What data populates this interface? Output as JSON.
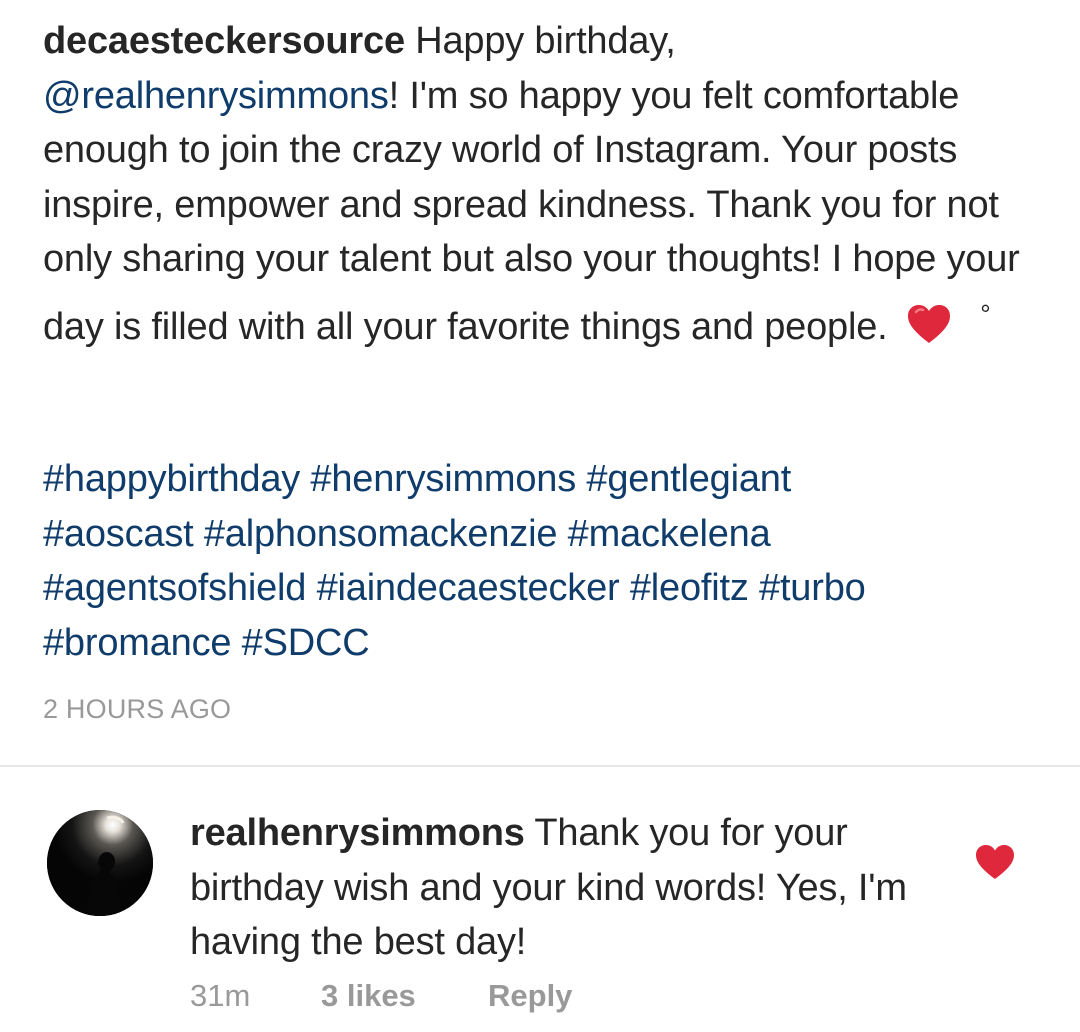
{
  "post": {
    "username": "decaesteckersource",
    "caption_part1": "Happy birthday,",
    "mention": "@realhenrysimmons",
    "caption_part2": "! I'm so happy you felt comfortable enough to join the crazy world of Instagram. Your posts inspire, empower and spread kindness. Thank you for not only sharing your talent but also your thoughts! I hope your day is filled with all your favorite things and people.",
    "caption_tail": "°",
    "hashtags": [
      "#happybirthday",
      "#henrysimmons",
      "#gentlegiant",
      "#aoscast",
      "#alphonsomackenzie",
      "#mackelena",
      "#agentsofshield",
      "#iaindecaestecker",
      "#leofitz",
      "#turbo",
      "#bromance",
      "#SDCC"
    ],
    "timestamp": "2 HOURS AGO"
  },
  "reply": {
    "username": "realhenrysimmons",
    "text": "Thank you for your birthday wish and your kind words! Yes, I'm having the best day!",
    "time": "31m",
    "likes": "3 likes",
    "reply_label": "Reply"
  },
  "colors": {
    "link": "#0f3c6b",
    "heart": "#e0283c",
    "meta": "#999999",
    "text": "#262626"
  },
  "icons": {
    "emoji": "red-heart-emoji",
    "like": "heart-icon",
    "avatar": "avatar"
  }
}
